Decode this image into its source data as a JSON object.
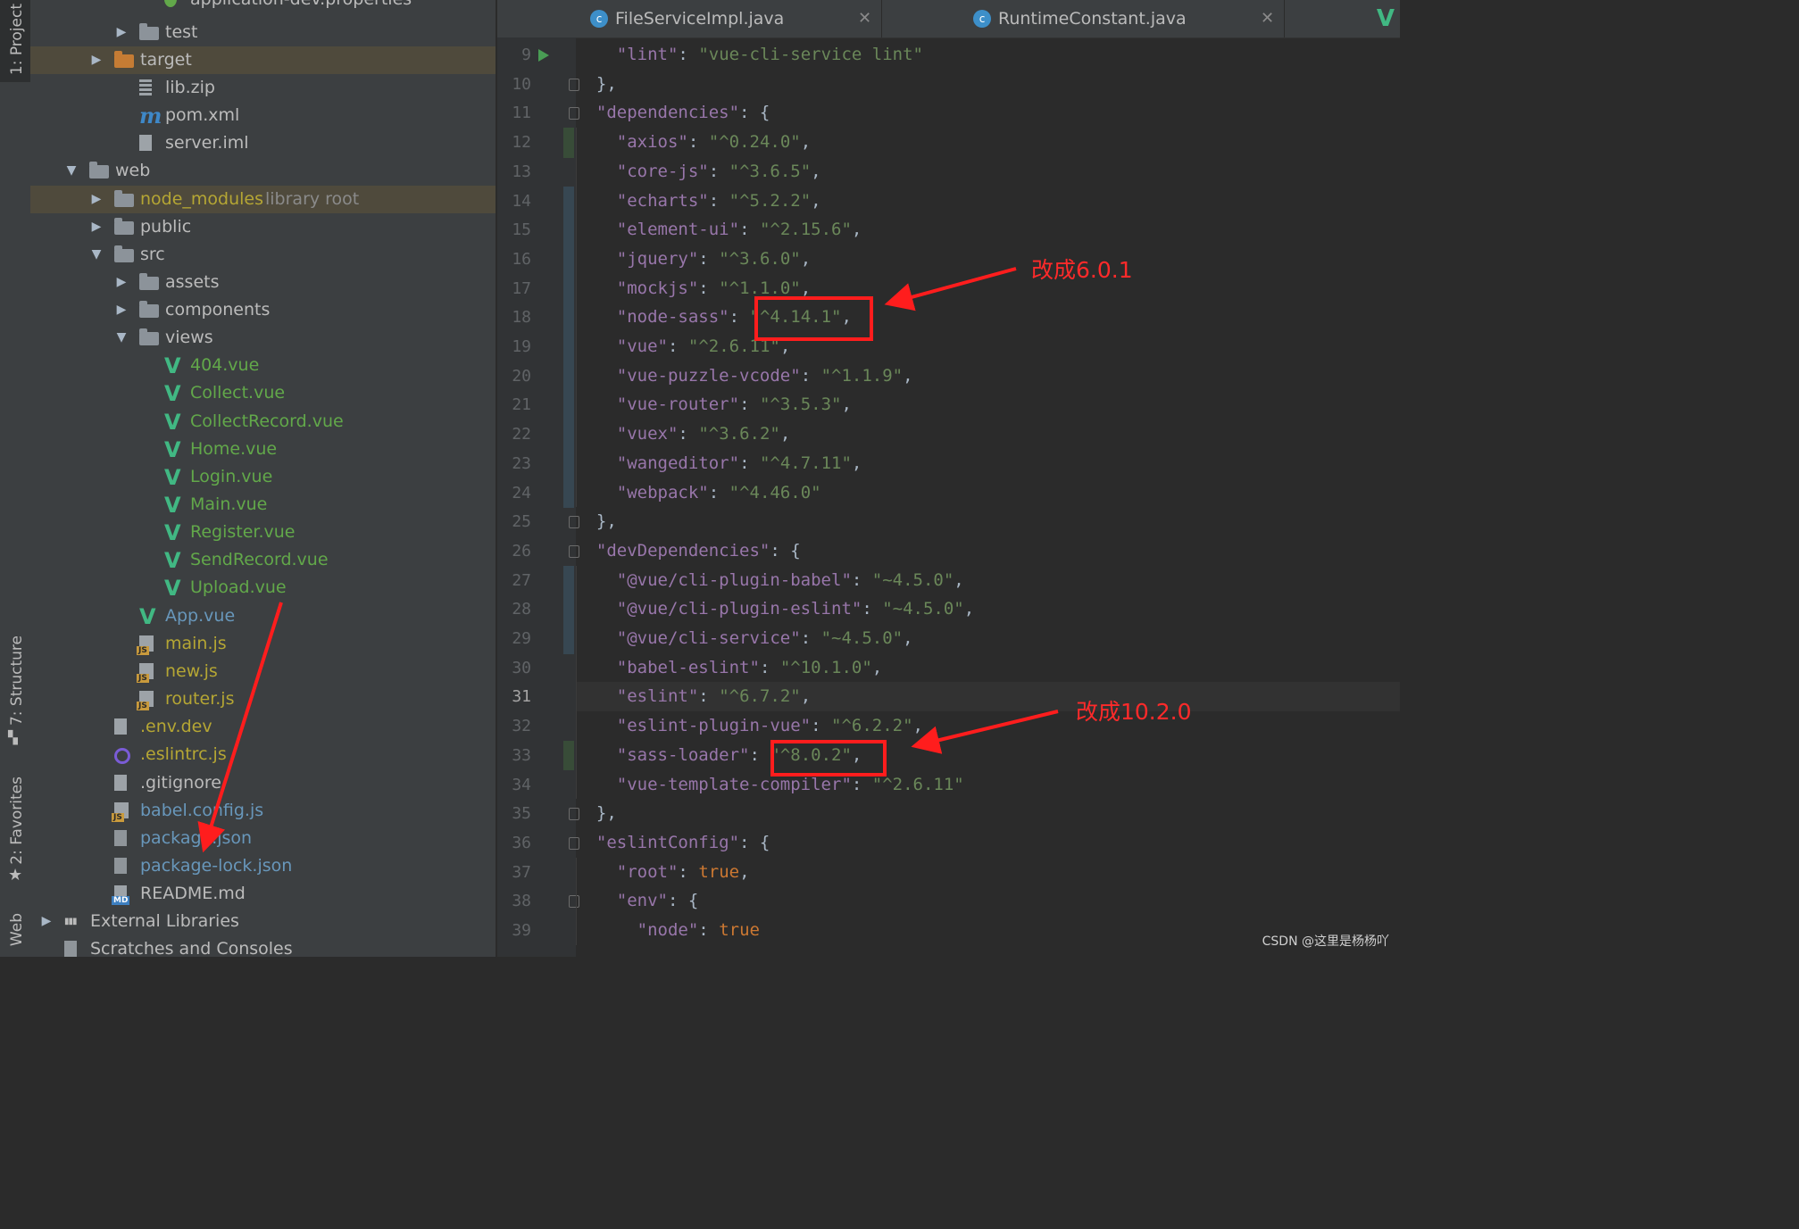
{
  "tool_strip": {
    "project_tab": "1: Project",
    "structure_tab": "7: Structure",
    "favorites_tab": "2: Favorites",
    "web_tab": "Web"
  },
  "project_tree": {
    "items": [
      {
        "label": "application-dev.properties",
        "icon": "spring-properties-icon"
      },
      {
        "label": "test",
        "icon": "folder-icon"
      },
      {
        "label": "target",
        "icon": "folder-excluded-icon"
      },
      {
        "label": "lib.zip",
        "icon": "archive-icon"
      },
      {
        "label": "pom.xml",
        "icon": "maven-icon"
      },
      {
        "label": "server.iml",
        "icon": "module-file-icon"
      },
      {
        "label": "web",
        "icon": "folder-icon"
      },
      {
        "label": "node_modules",
        "suffix": "library root",
        "icon": "folder-icon"
      },
      {
        "label": "public",
        "icon": "folder-icon"
      },
      {
        "label": "src",
        "icon": "folder-icon"
      },
      {
        "label": "assets",
        "icon": "folder-icon"
      },
      {
        "label": "components",
        "icon": "folder-icon"
      },
      {
        "label": "views",
        "icon": "folder-icon"
      },
      {
        "label": "404.vue",
        "icon": "vue-icon"
      },
      {
        "label": "Collect.vue",
        "icon": "vue-icon"
      },
      {
        "label": "CollectRecord.vue",
        "icon": "vue-icon"
      },
      {
        "label": "Home.vue",
        "icon": "vue-icon"
      },
      {
        "label": "Login.vue",
        "icon": "vue-icon"
      },
      {
        "label": "Main.vue",
        "icon": "vue-icon"
      },
      {
        "label": "Register.vue",
        "icon": "vue-icon"
      },
      {
        "label": "SendRecord.vue",
        "icon": "vue-icon"
      },
      {
        "label": "Upload.vue",
        "icon": "vue-icon"
      },
      {
        "label": "App.vue",
        "icon": "vue-icon"
      },
      {
        "label": "main.js",
        "icon": "js-file-icon"
      },
      {
        "label": "new.js",
        "icon": "js-file-icon"
      },
      {
        "label": "router.js",
        "icon": "js-file-icon"
      },
      {
        "label": ".env.dev",
        "icon": "text-file-icon"
      },
      {
        "label": ".eslintrc.js",
        "icon": "eslint-icon"
      },
      {
        "label": ".gitignore",
        "icon": "ignore-file-icon"
      },
      {
        "label": "babel.config.js",
        "icon": "js-file-icon"
      },
      {
        "label": "package.json",
        "icon": "json-file-icon"
      },
      {
        "label": "package-lock.json",
        "icon": "json-file-icon"
      },
      {
        "label": "README.md",
        "icon": "markdown-icon"
      },
      {
        "label": "External Libraries",
        "icon": "libraries-icon"
      },
      {
        "label": "Scratches and Consoles",
        "icon": "scratches-icon"
      }
    ]
  },
  "editor": {
    "tabs": [
      {
        "label": "FileServiceImpl.java",
        "icon": "java-class-icon"
      },
      {
        "label": "RuntimeConstant.java",
        "icon": "java-class-icon"
      }
    ],
    "current_line": 31,
    "lines": [
      {
        "n": "9",
        "tokens": [
          [
            "p",
            "  "
          ],
          [
            "k",
            "\"lint\""
          ],
          [
            "p",
            ": "
          ],
          [
            "s",
            "\"vue-cli-service lint\""
          ]
        ]
      },
      {
        "n": "10",
        "tokens": [
          [
            "p",
            "},"
          ]
        ]
      },
      {
        "n": "11",
        "tokens": [
          [
            "k",
            "\"dependencies\""
          ],
          [
            "p",
            ": {"
          ]
        ]
      },
      {
        "n": "12",
        "tokens": [
          [
            "p",
            "  "
          ],
          [
            "k",
            "\"axios\""
          ],
          [
            "p",
            ": "
          ],
          [
            "s",
            "\"^0.24.0\""
          ],
          [
            "p",
            ","
          ]
        ]
      },
      {
        "n": "13",
        "tokens": [
          [
            "p",
            "  "
          ],
          [
            "k",
            "\"core-js\""
          ],
          [
            "p",
            ": "
          ],
          [
            "s",
            "\"^3.6.5\""
          ],
          [
            "p",
            ","
          ]
        ]
      },
      {
        "n": "14",
        "tokens": [
          [
            "p",
            "  "
          ],
          [
            "k",
            "\"echarts\""
          ],
          [
            "p",
            ": "
          ],
          [
            "s",
            "\"^5.2.2\""
          ],
          [
            "p",
            ","
          ]
        ]
      },
      {
        "n": "15",
        "tokens": [
          [
            "p",
            "  "
          ],
          [
            "k",
            "\"element-ui\""
          ],
          [
            "p",
            ": "
          ],
          [
            "s",
            "\"^2.15.6\""
          ],
          [
            "p",
            ","
          ]
        ]
      },
      {
        "n": "16",
        "tokens": [
          [
            "p",
            "  "
          ],
          [
            "k",
            "\"jquery\""
          ],
          [
            "p",
            ": "
          ],
          [
            "s",
            "\"^3.6.0\""
          ],
          [
            "p",
            ","
          ]
        ]
      },
      {
        "n": "17",
        "tokens": [
          [
            "p",
            "  "
          ],
          [
            "k",
            "\"mockjs\""
          ],
          [
            "p",
            ": "
          ],
          [
            "s",
            "\"^1.1.0\""
          ],
          [
            "p",
            ","
          ]
        ]
      },
      {
        "n": "18",
        "tokens": [
          [
            "p",
            "  "
          ],
          [
            "k",
            "\"node-sass\""
          ],
          [
            "p",
            ": "
          ],
          [
            "s",
            "\"^4.14.1\""
          ],
          [
            "p",
            ","
          ]
        ]
      },
      {
        "n": "19",
        "tokens": [
          [
            "p",
            "  "
          ],
          [
            "k",
            "\"vue\""
          ],
          [
            "p",
            ": "
          ],
          [
            "s",
            "\"^2.6.11\""
          ],
          [
            "p",
            ","
          ]
        ]
      },
      {
        "n": "20",
        "tokens": [
          [
            "p",
            "  "
          ],
          [
            "k",
            "\"vue-puzzle-vcode\""
          ],
          [
            "p",
            ": "
          ],
          [
            "s",
            "\"^1.1.9\""
          ],
          [
            "p",
            ","
          ]
        ]
      },
      {
        "n": "21",
        "tokens": [
          [
            "p",
            "  "
          ],
          [
            "k",
            "\"vue-router\""
          ],
          [
            "p",
            ": "
          ],
          [
            "s",
            "\"^3.5.3\""
          ],
          [
            "p",
            ","
          ]
        ]
      },
      {
        "n": "22",
        "tokens": [
          [
            "p",
            "  "
          ],
          [
            "k",
            "\"vuex\""
          ],
          [
            "p",
            ": "
          ],
          [
            "s",
            "\"^3.6.2\""
          ],
          [
            "p",
            ","
          ]
        ]
      },
      {
        "n": "23",
        "tokens": [
          [
            "p",
            "  "
          ],
          [
            "k",
            "\"wangeditor\""
          ],
          [
            "p",
            ": "
          ],
          [
            "s",
            "\"^4.7.11\""
          ],
          [
            "p",
            ","
          ]
        ]
      },
      {
        "n": "24",
        "tokens": [
          [
            "p",
            "  "
          ],
          [
            "k",
            "\"webpack\""
          ],
          [
            "p",
            ": "
          ],
          [
            "s",
            "\"^4.46.0\""
          ]
        ]
      },
      {
        "n": "25",
        "tokens": [
          [
            "p",
            "},"
          ]
        ]
      },
      {
        "n": "26",
        "tokens": [
          [
            "k",
            "\"devDependencies\""
          ],
          [
            "p",
            ": {"
          ]
        ]
      },
      {
        "n": "27",
        "tokens": [
          [
            "p",
            "  "
          ],
          [
            "k",
            "\"@vue/cli-plugin-babel\""
          ],
          [
            "p",
            ": "
          ],
          [
            "s",
            "\"~4.5.0\""
          ],
          [
            "p",
            ","
          ]
        ]
      },
      {
        "n": "28",
        "tokens": [
          [
            "p",
            "  "
          ],
          [
            "k",
            "\"@vue/cli-plugin-eslint\""
          ],
          [
            "p",
            ": "
          ],
          [
            "s",
            "\"~4.5.0\""
          ],
          [
            "p",
            ","
          ]
        ]
      },
      {
        "n": "29",
        "tokens": [
          [
            "p",
            "  "
          ],
          [
            "k",
            "\"@vue/cli-service\""
          ],
          [
            "p",
            ": "
          ],
          [
            "s",
            "\"~4.5.0\""
          ],
          [
            "p",
            ","
          ]
        ]
      },
      {
        "n": "30",
        "tokens": [
          [
            "p",
            "  "
          ],
          [
            "k",
            "\"babel-eslint\""
          ],
          [
            "p",
            ": "
          ],
          [
            "s",
            "\"^10.1.0\""
          ],
          [
            "p",
            ","
          ]
        ]
      },
      {
        "n": "31",
        "tokens": [
          [
            "p",
            "  "
          ],
          [
            "k",
            "\"eslint\""
          ],
          [
            "p",
            ": "
          ],
          [
            "s",
            "\"^6.7.2\""
          ],
          [
            "p",
            ","
          ]
        ]
      },
      {
        "n": "32",
        "tokens": [
          [
            "p",
            "  "
          ],
          [
            "k",
            "\"eslint-plugin-vue\""
          ],
          [
            "p",
            ": "
          ],
          [
            "s",
            "\"^6.2.2\""
          ],
          [
            "p",
            ","
          ]
        ]
      },
      {
        "n": "33",
        "tokens": [
          [
            "p",
            "  "
          ],
          [
            "k",
            "\"sass-loader\""
          ],
          [
            "p",
            ": "
          ],
          [
            "s",
            "\"^8.0.2\""
          ],
          [
            "p",
            ","
          ]
        ]
      },
      {
        "n": "34",
        "tokens": [
          [
            "p",
            "  "
          ],
          [
            "k",
            "\"vue-template-compiler\""
          ],
          [
            "p",
            ": "
          ],
          [
            "s",
            "\"^2.6.11\""
          ]
        ]
      },
      {
        "n": "35",
        "tokens": [
          [
            "p",
            "},"
          ]
        ]
      },
      {
        "n": "36",
        "tokens": [
          [
            "k",
            "\"eslintConfig\""
          ],
          [
            "p",
            ": {"
          ]
        ]
      },
      {
        "n": "37",
        "tokens": [
          [
            "p",
            "  "
          ],
          [
            "k",
            "\"root\""
          ],
          [
            "p",
            ": "
          ],
          [
            "kw",
            "true"
          ],
          [
            "p",
            ","
          ]
        ]
      },
      {
        "n": "38",
        "tokens": [
          [
            "p",
            "  "
          ],
          [
            "k",
            "\"env\""
          ],
          [
            "p",
            ": {"
          ]
        ]
      },
      {
        "n": "39",
        "tokens": [
          [
            "p",
            "    "
          ],
          [
            "k",
            "\"node\""
          ],
          [
            "p",
            ": "
          ],
          [
            "kw",
            "true"
          ]
        ]
      }
    ]
  },
  "annotations": {
    "note_node_sass": "改成6.0.1",
    "note_sass_loader": "改成10.2.0",
    "color": "#ff1d1d"
  },
  "watermark": "CSDN @这里是杨杨吖",
  "colors": {
    "tree_bg": "#3c3f41",
    "editor_bg": "#2b2b2b",
    "json_key": "#9876aa",
    "json_string": "#6a8759",
    "json_keyword": "#cc7832",
    "vue_file": "#62a84a",
    "js_file": "#b5a634"
  }
}
